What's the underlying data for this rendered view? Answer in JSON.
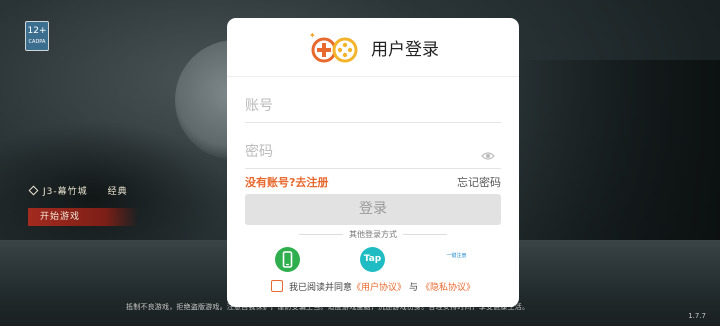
{
  "background": {
    "age_rating": "12+",
    "age_rating_sub": "CADPA",
    "server_name": "J3-幕竹城",
    "server_tag": "经典",
    "start_game_label": "开始游戏",
    "health_notice": "抵制不良游戏，拒绝盗版游戏。注意自我保护，谨防受骗上当。适度游戏益脑，沉迷游戏伤身。合理安排时间，享受健康生活。",
    "version": "1.7.7"
  },
  "login_dialog": {
    "title": "用户登录",
    "account_placeholder": "账号",
    "password_placeholder": "密码",
    "register_link": "没有账号?去注册",
    "forgot_password_link": "忘记密码",
    "login_button": "登录",
    "other_login_label": "其他登录方式",
    "login_methods": [
      {
        "name": "phone",
        "label": ""
      },
      {
        "name": "taptap",
        "label": "Tap"
      },
      {
        "name": "one-click-register",
        "label": "一键注册"
      }
    ],
    "agreement": {
      "prefix": "我已阅读并同意",
      "user_agreement": "《用户协议》",
      "and": "与",
      "privacy_policy": "《隐私协议》"
    }
  },
  "colors": {
    "accent": "#e8692e",
    "phone_green": "#2fae4e",
    "tap_teal": "#1fbcc4",
    "login_button_bg": "#e2e2e2"
  }
}
